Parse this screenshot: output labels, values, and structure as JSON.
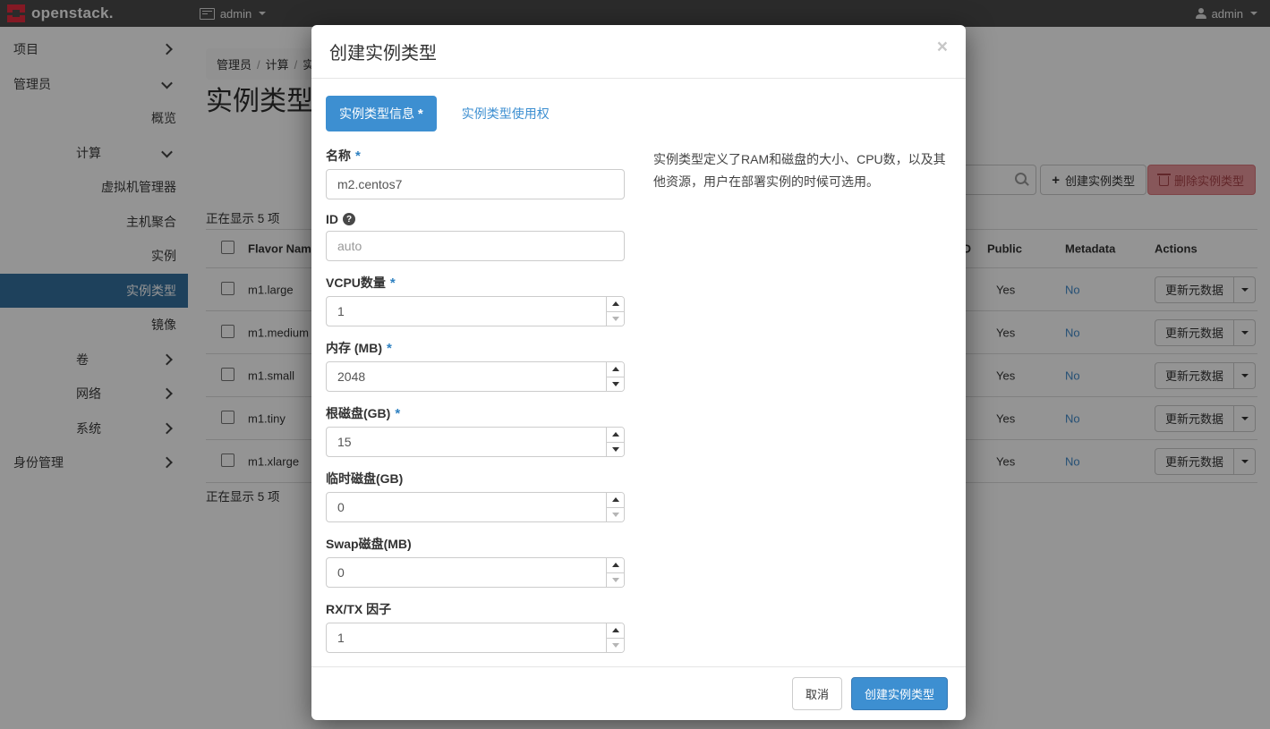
{
  "colors": {
    "accent_blue": "#3d8fd1",
    "sidebar_selected": "#35719f",
    "danger_muted_bg": "#e9969b",
    "topbar_bg": "#4a4a4a",
    "link_blue": "#428bca",
    "logo_red": "#e32b3f"
  },
  "topbar": {
    "brand": "openstack.",
    "project_menu": "admin",
    "user_menu": "admin"
  },
  "sidebar": {
    "items": [
      {
        "label": "项目",
        "level": 1,
        "caret": "right",
        "selected": false
      },
      {
        "label": "管理员",
        "level": 1,
        "caret": "down",
        "selected": false
      },
      {
        "label": "概览",
        "level": 3,
        "caret": "none",
        "selected": false
      },
      {
        "label": "计算",
        "level": 2,
        "caret": "down",
        "selected": false
      },
      {
        "label": "虚拟机管理器",
        "level": 3,
        "caret": "none",
        "selected": false
      },
      {
        "label": "主机聚合",
        "level": 3,
        "caret": "none",
        "selected": false
      },
      {
        "label": "实例",
        "level": 3,
        "caret": "none",
        "selected": false
      },
      {
        "label": "实例类型",
        "level": 3,
        "caret": "none",
        "selected": true
      },
      {
        "label": "镜像",
        "level": 3,
        "caret": "none",
        "selected": false
      },
      {
        "label": "卷",
        "level": 2,
        "caret": "right",
        "selected": false
      },
      {
        "label": "网络",
        "level": 2,
        "caret": "right",
        "selected": false
      },
      {
        "label": "系统",
        "level": 2,
        "caret": "right",
        "selected": false
      },
      {
        "label": "身份管理",
        "level": 1,
        "caret": "right",
        "selected": false
      }
    ]
  },
  "page": {
    "breadcrumb": [
      "管理员",
      "计算",
      "实例类型"
    ],
    "title": "实例类型",
    "showing_text": "正在显示 5 项",
    "create_button": "创建实例类型",
    "delete_button": "删除实例类型",
    "plus_glyph": "+"
  },
  "table": {
    "headers": {
      "flavor": "Flavor Name",
      "id": "ID",
      "public": "Public",
      "metadata": "Metadata",
      "actions": "Actions"
    },
    "rows": [
      {
        "name": "m1.large",
        "public": "Yes",
        "metadata": "No",
        "action": "更新元数据"
      },
      {
        "name": "m1.medium",
        "public": "Yes",
        "metadata": "No",
        "action": "更新元数据"
      },
      {
        "name": "m1.small",
        "public": "Yes",
        "metadata": "No",
        "action": "更新元数据"
      },
      {
        "name": "m1.tiny",
        "public": "Yes",
        "metadata": "No",
        "action": "更新元数据"
      },
      {
        "name": "m1.xlarge",
        "public": "Yes",
        "metadata": "No",
        "action": "更新元数据"
      }
    ]
  },
  "modal": {
    "title": "创建实例类型",
    "close_glyph": "×",
    "required_marker": "*",
    "help_glyph": "?",
    "tabs": [
      {
        "label": "实例类型信息",
        "required": true
      },
      {
        "label": "实例类型使用权",
        "required": false
      }
    ],
    "help_text": "实例类型定义了RAM和磁盘的大小、CPU数，以及其他资源，用户在部署实例的时候可选用。",
    "fields": [
      {
        "label": "名称",
        "required": true,
        "help_icon": false,
        "value": "m2.centos7",
        "type": "text",
        "muted": false,
        "down_disabled": false
      },
      {
        "label": "ID",
        "required": false,
        "help_icon": true,
        "value": "auto",
        "type": "text",
        "muted": true,
        "down_disabled": false
      },
      {
        "label": "VCPU数量",
        "required": true,
        "help_icon": false,
        "value": "1",
        "type": "number",
        "muted": false,
        "down_disabled": true
      },
      {
        "label": "内存 (MB)",
        "required": true,
        "help_icon": false,
        "value": "2048",
        "type": "number",
        "muted": false,
        "down_disabled": false
      },
      {
        "label": "根磁盘(GB)",
        "required": true,
        "help_icon": false,
        "value": "15",
        "type": "number",
        "muted": false,
        "down_disabled": false
      },
      {
        "label": "临时磁盘(GB)",
        "required": false,
        "help_icon": false,
        "value": "0",
        "type": "number",
        "muted": false,
        "down_disabled": true
      },
      {
        "label": "Swap磁盘(MB)",
        "required": false,
        "help_icon": false,
        "value": "0",
        "type": "number",
        "muted": false,
        "down_disabled": true
      },
      {
        "label": "RX/TX 因子",
        "required": false,
        "help_icon": false,
        "value": "1",
        "type": "number",
        "muted": false,
        "down_disabled": true
      }
    ],
    "cancel_button": "取消",
    "submit_button": "创建实例类型"
  }
}
